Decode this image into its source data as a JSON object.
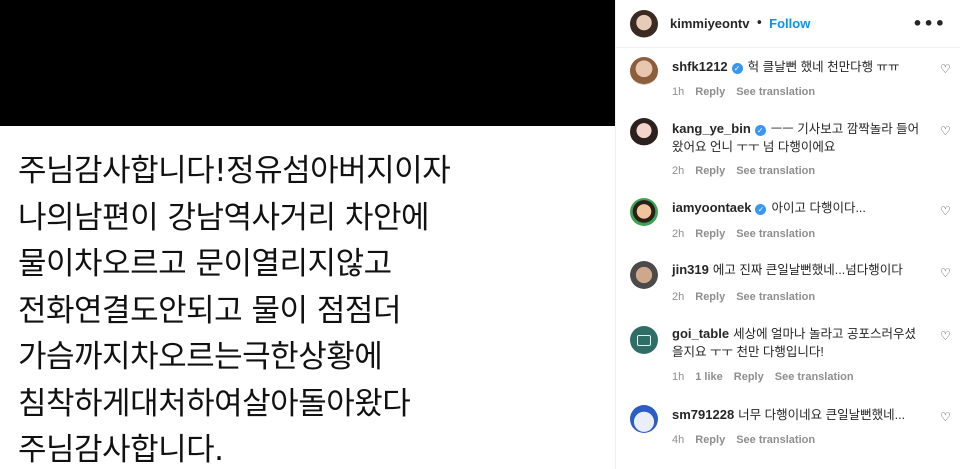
{
  "post": {
    "lines": [
      "주님감사합니다!정유섬아버지이자",
      "나의남편이 강남역사거리 차안에",
      "물이차오르고 문이열리지않고",
      "전화연결도안되고 물이 점점더",
      "가슴까지차오르는극한상황에",
      "침착하게대처하여살아돌아왔다",
      "주님감사합니다."
    ]
  },
  "header": {
    "username": "kimmiyeontv",
    "separator": "•",
    "follow_label": "Follow",
    "more_label": "•••"
  },
  "comments": [
    {
      "username": "shfk1212",
      "verified": true,
      "text": "헉 클날뻔 했네 천만다행 ㅠㅠ",
      "time": "1h",
      "likes": "",
      "reply": "Reply",
      "translate": "See translation"
    },
    {
      "username": "kang_ye_bin",
      "verified": true,
      "text": "ㅡㅡ 기사보고 깜짝놀라 들어왔어요 언니 ㅜㅜ 넘 다행이에요",
      "time": "2h",
      "likes": "",
      "reply": "Reply",
      "translate": "See translation"
    },
    {
      "username": "iamyoontaek",
      "verified": true,
      "text": "아이고 다행이다...",
      "time": "2h",
      "likes": "",
      "reply": "Reply",
      "translate": "See translation"
    },
    {
      "username": "jin319",
      "verified": false,
      "text": "에고 진짜 큰일날뻔했네...넘다행이다",
      "time": "2h",
      "likes": "",
      "reply": "Reply",
      "translate": "See translation"
    },
    {
      "username": "goi_table",
      "verified": false,
      "text": "세상에 얼마나 놀라고 공포스러우셨을지요 ㅜㅜ 천만 다행입니다!",
      "time": "1h",
      "likes": "1 like",
      "reply": "Reply",
      "translate": "See translation"
    },
    {
      "username": "sm791228",
      "verified": false,
      "text": "너무 다행이네요 큰일날뻔했네...",
      "time": "4h",
      "likes": "",
      "reply": "Reply",
      "translate": "See translation"
    }
  ],
  "icons": {
    "heart": "♡",
    "verified": "✓"
  },
  "colors": {
    "accent": "#0095f6",
    "verified": "#3897f0",
    "meta": "#8e8e8e"
  }
}
